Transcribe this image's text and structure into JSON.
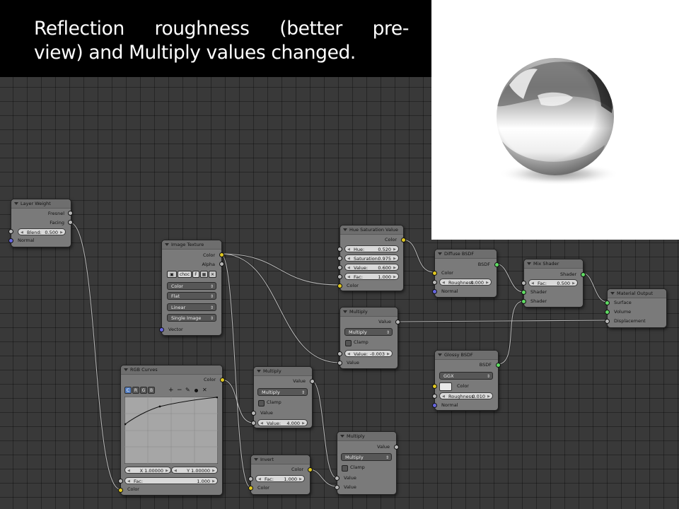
{
  "caption": {
    "line1": "Reflection roughness (better pre-",
    "line2": "view) and Multiply values changed."
  },
  "nodes": {
    "layer_weight": {
      "title": "Layer Weight",
      "fresnel": "Fresnel",
      "facing": "Facing",
      "blend_label": "Blend:",
      "blend_value": "0.500",
      "normal": "Normal"
    },
    "image_texture": {
      "title": "Image Texture",
      "color": "Color",
      "alpha": "Alpha",
      "image_name": "choc",
      "fake_user": "F",
      "color_space": "Color",
      "projection": "Flat",
      "interpolation": "Linear",
      "extension": "Single Image",
      "vector": "Vector"
    },
    "hue_saturation": {
      "title": "Hue Saturation Value",
      "color_out": "Color",
      "hue_label": "Hue:",
      "hue_value": "0.520",
      "sat_label": "Saturation:",
      "sat_value": "0.975",
      "val_label": "Value:",
      "val_value": "0.600",
      "fac_label": "Fac:",
      "fac_value": "1.000",
      "color_in": "Color"
    },
    "diffuse": {
      "title": "Diffuse BSDF",
      "bsdf": "BSDF",
      "color": "Color",
      "rough_label": "Roughness:",
      "rough_value": "0.000",
      "normal": "Normal"
    },
    "mix_shader": {
      "title": "Mix Shader",
      "shader_out": "Shader",
      "fac_label": "Fac:",
      "fac_value": "0.500",
      "shader1": "Shader",
      "shader2": "Shader"
    },
    "material_output": {
      "title": "Material Output",
      "surface": "Surface",
      "volume": "Volume",
      "displacement": "Displacement"
    },
    "multiply1": {
      "title": "Multiply",
      "value_out": "Value",
      "op": "Multiply",
      "clamp": "Clamp",
      "val_label": "Value:",
      "val_value": "-0.003",
      "value_in": "Value"
    },
    "glossy": {
      "title": "Glossy BSDF",
      "bsdf": "BSDF",
      "distribution": "GGX",
      "color": "Color",
      "rough_label": "Roughness:",
      "rough_value": "0.010",
      "normal": "Normal"
    },
    "rgb_curves": {
      "title": "RGB Curves",
      "color_out": "Color",
      "tab_c": "C",
      "tab_r": "R",
      "tab_g": "G",
      "tab_b": "B",
      "x_readout": "X 1.00000",
      "y_readout": "Y 1.00000",
      "fac_label": "Fac:",
      "fac_value": "1.000",
      "color_in": "Color"
    },
    "multiply2": {
      "title": "Multiply",
      "value_out": "Value",
      "op": "Multiply",
      "clamp": "Clamp",
      "value_in": "Value",
      "val_label": "Value:",
      "val_value": "4.000"
    },
    "invert": {
      "title": "Invert",
      "color_out": "Color",
      "fac_label": "Fac:",
      "fac_value": "1.000",
      "color_in": "Color"
    },
    "multiply3": {
      "title": "Multiply",
      "value_out": "Value",
      "op": "Multiply",
      "clamp": "Clamp",
      "value_in1": "Value",
      "value_in2": "Value"
    }
  },
  "colors": {
    "socket_shader": "#5fdc63",
    "socket_value": "#b8b8b8",
    "socket_color": "#e0c820",
    "socket_vector": "#6767e0",
    "active_tab": "#5680c2"
  }
}
